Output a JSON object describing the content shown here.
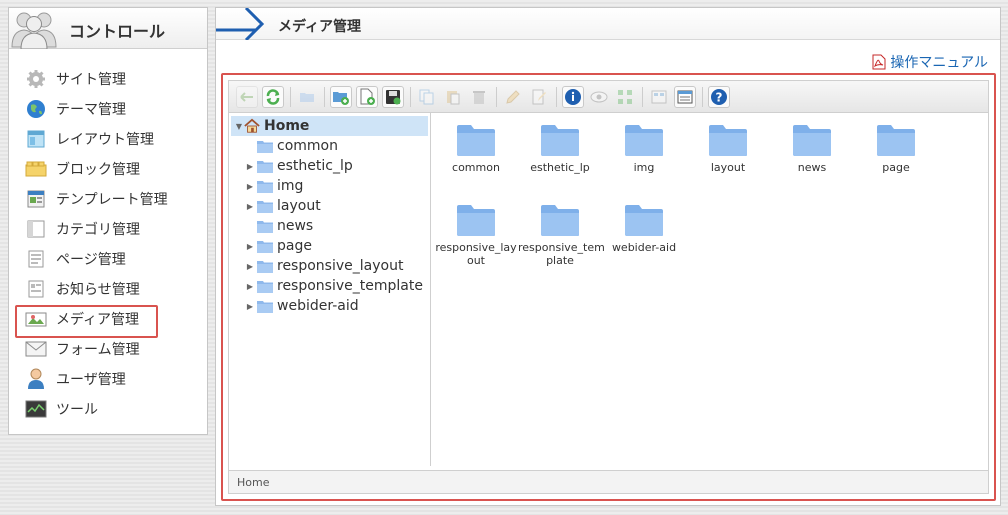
{
  "sidebar": {
    "title": "コントロール",
    "items": [
      {
        "label": "サイト管理",
        "icon": "gear-icon"
      },
      {
        "label": "テーマ管理",
        "icon": "globe-icon"
      },
      {
        "label": "レイアウト管理",
        "icon": "layout-icon"
      },
      {
        "label": "ブロック管理",
        "icon": "block-icon"
      },
      {
        "label": "テンプレート管理",
        "icon": "template-icon"
      },
      {
        "label": "カテゴリ管理",
        "icon": "category-icon"
      },
      {
        "label": "ページ管理",
        "icon": "page-icon"
      },
      {
        "label": "お知らせ管理",
        "icon": "news-icon"
      },
      {
        "label": "メディア管理",
        "icon": "media-icon",
        "active": true
      },
      {
        "label": "フォーム管理",
        "icon": "mail-icon"
      },
      {
        "label": "ユーザ管理",
        "icon": "user-icon"
      },
      {
        "label": "ツール",
        "icon": "tool-icon"
      }
    ]
  },
  "main": {
    "title": "メディア管理",
    "manual_link": "操作マニュアル"
  },
  "tree": {
    "root": "Home",
    "items": [
      {
        "label": "common",
        "expandable": false
      },
      {
        "label": "esthetic_lp",
        "expandable": true
      },
      {
        "label": "img",
        "expandable": true
      },
      {
        "label": "layout",
        "expandable": true
      },
      {
        "label": "news",
        "expandable": false
      },
      {
        "label": "page",
        "expandable": true
      },
      {
        "label": "responsive_layout",
        "expandable": true
      },
      {
        "label": "responsive_template",
        "expandable": true
      },
      {
        "label": "webider-aid",
        "expandable": true
      }
    ]
  },
  "grid": {
    "folders": [
      {
        "line1": "common",
        "line2": ""
      },
      {
        "line1": "esthetic_lp",
        "line2": ""
      },
      {
        "line1": "img",
        "line2": ""
      },
      {
        "line1": "layout",
        "line2": ""
      },
      {
        "line1": "news",
        "line2": ""
      },
      {
        "line1": "page",
        "line2": ""
      },
      {
        "line1": "responsive_lay",
        "line2": "out"
      },
      {
        "line1": "responsive_tem",
        "line2": "plate"
      },
      {
        "line1": "webider-aid",
        "line2": ""
      }
    ]
  },
  "status": {
    "path": "Home"
  },
  "colors": {
    "accent_red": "#d9534f",
    "folder_blue": "#8fb9ec",
    "link_blue": "#1a66b3",
    "selected_row": "#cfe4f7"
  }
}
